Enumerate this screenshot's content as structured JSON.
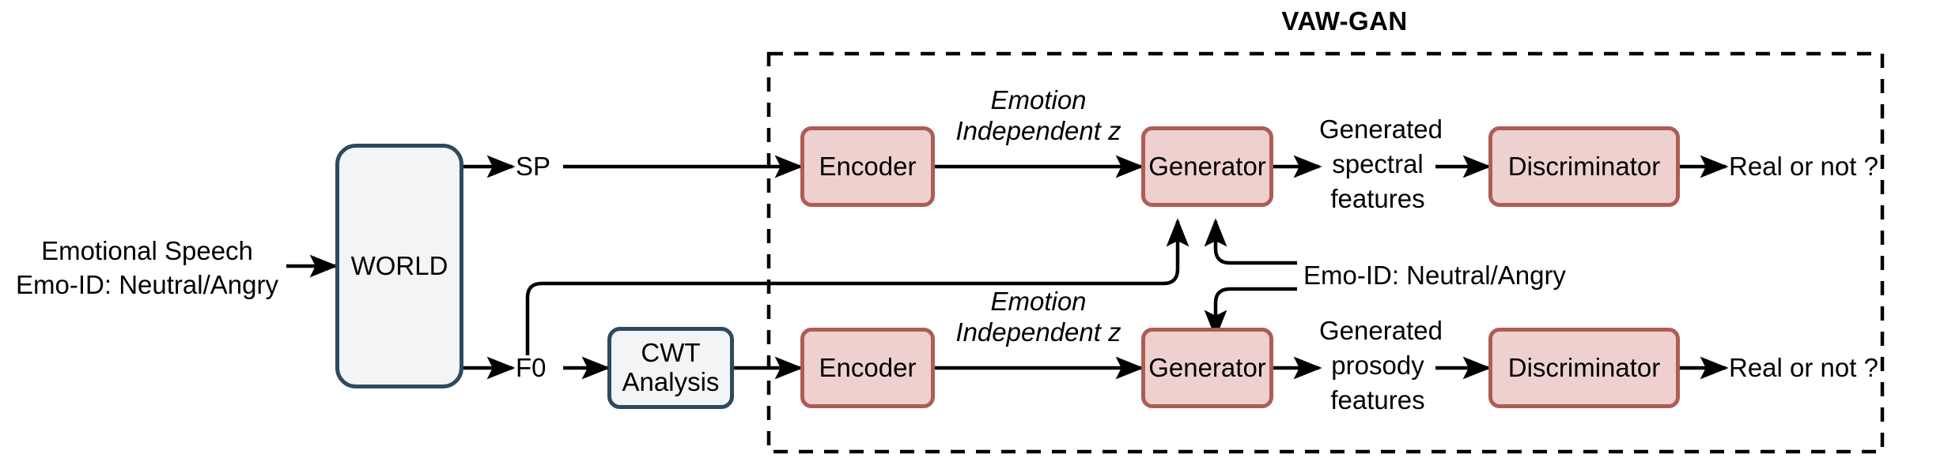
{
  "figure": {
    "title": "VAW-GAN",
    "group_box_label": "VAW-GAN"
  },
  "inputs": {
    "source_line1": "Emotional Speech",
    "source_line2": "Emo-ID: Neutral/Angry"
  },
  "analysis": {
    "world_label": "WORLD",
    "sp_label": "SP",
    "f0_label": "F0",
    "cwt_line1": "CWT",
    "cwt_line2": "Analysis"
  },
  "conditioning": {
    "emo_id_label": "Emo-ID: Neutral/Angry"
  },
  "spectral_branch": {
    "encoder_label": "Encoder",
    "latent_line1": "Emotion",
    "latent_line2": "Independent z",
    "generator_label": "Generator",
    "output_line1": "Generated",
    "output_line2": "spectral",
    "output_line3": "features",
    "discriminator_label": "Discriminator",
    "decision_label": "Real or not ?"
  },
  "prosody_branch": {
    "encoder_label": "Encoder",
    "latent_line1": "Emotion",
    "latent_line2": "Independent z",
    "generator_label": "Generator",
    "output_line1": "Generated",
    "output_line2": "prosody",
    "output_line3": "features",
    "discriminator_label": "Discriminator",
    "decision_label": "Real or not ?"
  },
  "colors": {
    "module_border_blue": "#2d4a5e",
    "module_fill_blue": "#f2f4f6",
    "module_border_red": "#ae5c55",
    "module_fill_red": "#eed1ce",
    "wire": "#000000",
    "group_border": "#000000",
    "text": "#000000"
  }
}
